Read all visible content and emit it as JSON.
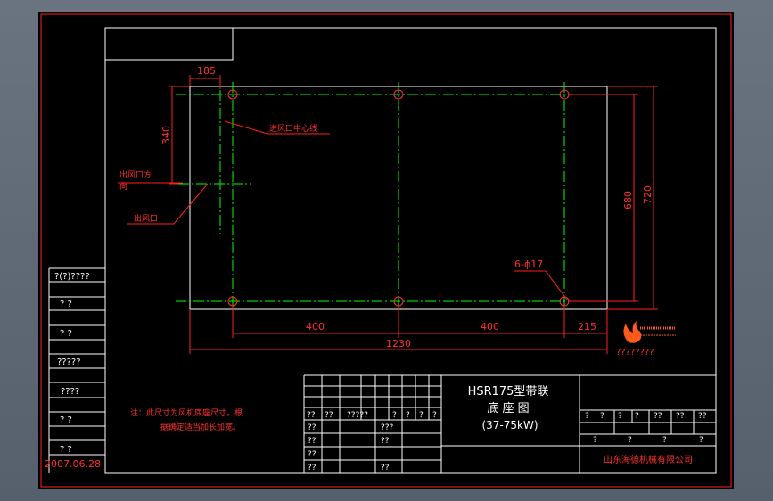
{
  "drawing": {
    "dimensions": {
      "d185": "185",
      "d340": "340",
      "d680": "680",
      "d720": "720",
      "d400_left": "400",
      "d400_right": "400",
      "d215": "215",
      "d1230": "1230",
      "holes": "6-ϕ17"
    },
    "annotations": {
      "inlet_centerline": "进风口中心线",
      "outlet_direction_1": "出风口方",
      "outlet_direction_2": "向",
      "outlet": "出风口"
    },
    "notes": {
      "line1": "注：此尺寸为风机底座尺寸，根",
      "line2": "据确定适当加长加宽。"
    },
    "title_block": {
      "title_line1": "HSR175型带联",
      "title_line2": "底 座 图",
      "title_line3": "(37-75kW)",
      "company": "山东海德机械有限公司",
      "logo_text": "????????",
      "mid_row1": [
        "??",
        "??",
        "?????",
        "?",
        "?",
        "?",
        "?"
      ],
      "mid_cells": [
        "???",
        "??",
        "??"
      ],
      "left_rows": [
        "??",
        "??",
        "??",
        "??"
      ],
      "right_row1": [
        "?",
        "?",
        "?",
        "?",
        "??",
        "??",
        "??"
      ],
      "right_row2": [
        "?",
        "?",
        "?",
        "?"
      ]
    },
    "left_strip": [
      "?(?)????",
      "?  ?",
      "?  ?",
      "?????",
      "????",
      "?  ?",
      "?  ?"
    ],
    "date": "2007.06.28"
  },
  "colors": {
    "background": "#000000",
    "frame": "#ffffff",
    "border_red": "#ff0000",
    "centerline": "#00ff00",
    "dimension": "#ff0000",
    "text_white": "#ffffff",
    "note_red": "#ff0000"
  }
}
